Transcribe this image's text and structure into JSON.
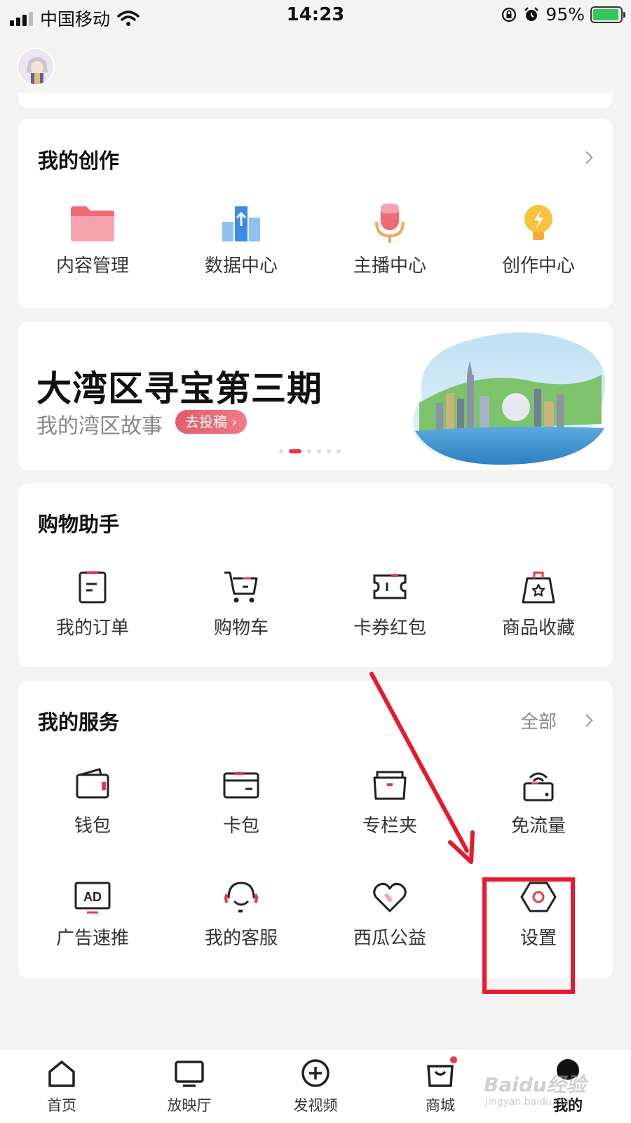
{
  "status_bar": {
    "carrier": "中国移动",
    "time": "14:23",
    "battery_percent": "95%"
  },
  "creation": {
    "title": "我的创作",
    "items": [
      {
        "label": "内容管理",
        "icon": "folder-icon"
      },
      {
        "label": "数据中心",
        "icon": "data-chart-icon"
      },
      {
        "label": "主播中心",
        "icon": "microphone-icon"
      },
      {
        "label": "创作中心",
        "icon": "lightbulb-icon"
      }
    ]
  },
  "banner": {
    "title": "大湾区寻宝第三期",
    "subtitle": "我的湾区故事",
    "button": "去投稿"
  },
  "shopping": {
    "title": "购物助手",
    "items": [
      {
        "label": "我的订单",
        "icon": "order-icon"
      },
      {
        "label": "购物车",
        "icon": "cart-icon"
      },
      {
        "label": "卡券红包",
        "icon": "coupon-icon"
      },
      {
        "label": "商品收藏",
        "icon": "favorite-bag-icon"
      }
    ]
  },
  "services": {
    "title": "我的服务",
    "more": "全部",
    "items": [
      {
        "label": "钱包",
        "icon": "wallet-icon"
      },
      {
        "label": "卡包",
        "icon": "card-icon"
      },
      {
        "label": "专栏夹",
        "icon": "column-folder-icon"
      },
      {
        "label": "免流量",
        "icon": "free-data-icon"
      },
      {
        "label": "广告速推",
        "icon": "ad-icon"
      },
      {
        "label": "我的客服",
        "icon": "headset-icon"
      },
      {
        "label": "西瓜公益",
        "icon": "heart-icon"
      },
      {
        "label": "设置",
        "icon": "settings-icon"
      }
    ]
  },
  "bottom_nav": [
    {
      "label": "首页",
      "icon": "home-icon"
    },
    {
      "label": "放映厅",
      "icon": "tv-icon"
    },
    {
      "label": "发视频",
      "icon": "add-video-icon"
    },
    {
      "label": "商城",
      "icon": "shop-bag-icon"
    },
    {
      "label": "我的",
      "icon": "profile-icon"
    }
  ],
  "watermark": {
    "text": "Baidu经验",
    "url": "jingyan.baidu.com"
  },
  "colors": {
    "accent": "#e8394a",
    "highlight": "#e8192d",
    "text": "#222222",
    "background": "#f3f3f3"
  }
}
